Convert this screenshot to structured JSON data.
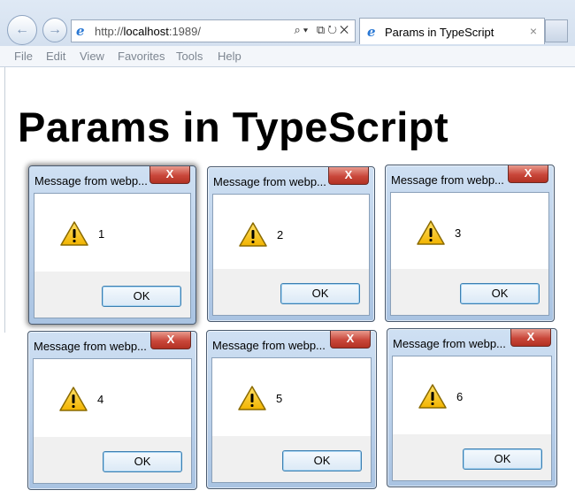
{
  "browser": {
    "url_prefix": "http://",
    "url_host": "localhost",
    "url_suffix": ":1989/",
    "tab_title": "Params in TypeScript",
    "tab_close": "×",
    "address_tools": "⌕▾ ⧉↻✕",
    "menu": [
      "File",
      "Edit",
      "View",
      "Favorites",
      "Tools",
      "Help"
    ]
  },
  "page": {
    "title": "Params in TypeScript"
  },
  "dialogs": [
    {
      "title": "Message from webp...",
      "message": "1",
      "ok_label": "OK",
      "close_label": "X"
    },
    {
      "title": "Message from webp...",
      "message": "2",
      "ok_label": "OK",
      "close_label": "X"
    },
    {
      "title": "Message from webp...",
      "message": "3",
      "ok_label": "OK",
      "close_label": "X"
    },
    {
      "title": "Message from webp...",
      "message": "4",
      "ok_label": "OK",
      "close_label": "X"
    },
    {
      "title": "Message from webp...",
      "message": "5",
      "ok_label": "OK",
      "close_label": "X"
    },
    {
      "title": "Message from webp...",
      "message": "6",
      "ok_label": "OK",
      "close_label": "X"
    }
  ],
  "icons": {
    "back": "back-arrow-icon",
    "forward": "forward-arrow-icon",
    "dialog": "warning-icon"
  }
}
